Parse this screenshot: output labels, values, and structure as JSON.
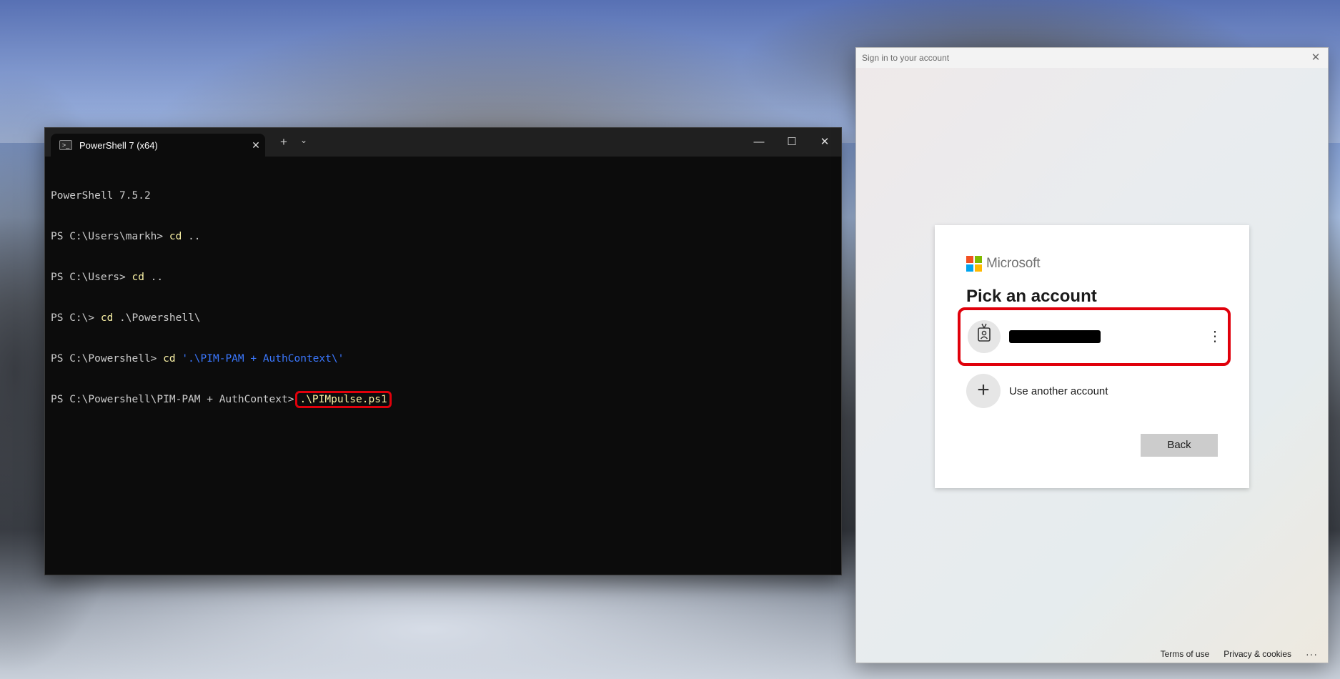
{
  "terminal": {
    "tab_title": "PowerShell 7 (x64)",
    "tab_close": "✕",
    "new_tab": "+",
    "dropdown": "⌄",
    "minimize": "—",
    "maximize": "☐",
    "close": "✕",
    "lines": [
      {
        "text": "PowerShell 7.5.2"
      },
      {
        "prompt": "PS C:\\Users\\markh> ",
        "cmd": "cd",
        "rest": " .."
      },
      {
        "prompt": "PS C:\\Users> ",
        "cmd": "cd",
        "rest": " .."
      },
      {
        "prompt": "PS C:\\> ",
        "cmd": "cd",
        "rest": " .\\Powershell\\"
      },
      {
        "prompt": "PS C:\\Powershell> ",
        "cmd": "cd",
        "rest": " ",
        "string": "'.\\PIM-PAM + AuthContext\\'"
      },
      {
        "prompt": "PS C:\\Powershell\\PIM-PAM + AuthContext>",
        "highlighted_cmd": ".\\PIMpulse.ps1"
      }
    ]
  },
  "signin": {
    "window_title": "Sign in to your account",
    "close": "✕",
    "brand": "Microsoft",
    "heading": "Pick an account",
    "account_more": "⋮",
    "use_another": "Use another account",
    "back": "Back",
    "footer": {
      "terms": "Terms of use",
      "privacy": "Privacy & cookies",
      "more": "···"
    }
  },
  "colors": {
    "highlight_border": "#e0000b",
    "terminal_bg": "#0c0c0c",
    "command_yellow": "#f9f1a5",
    "string_blue": "#3b78ff"
  }
}
